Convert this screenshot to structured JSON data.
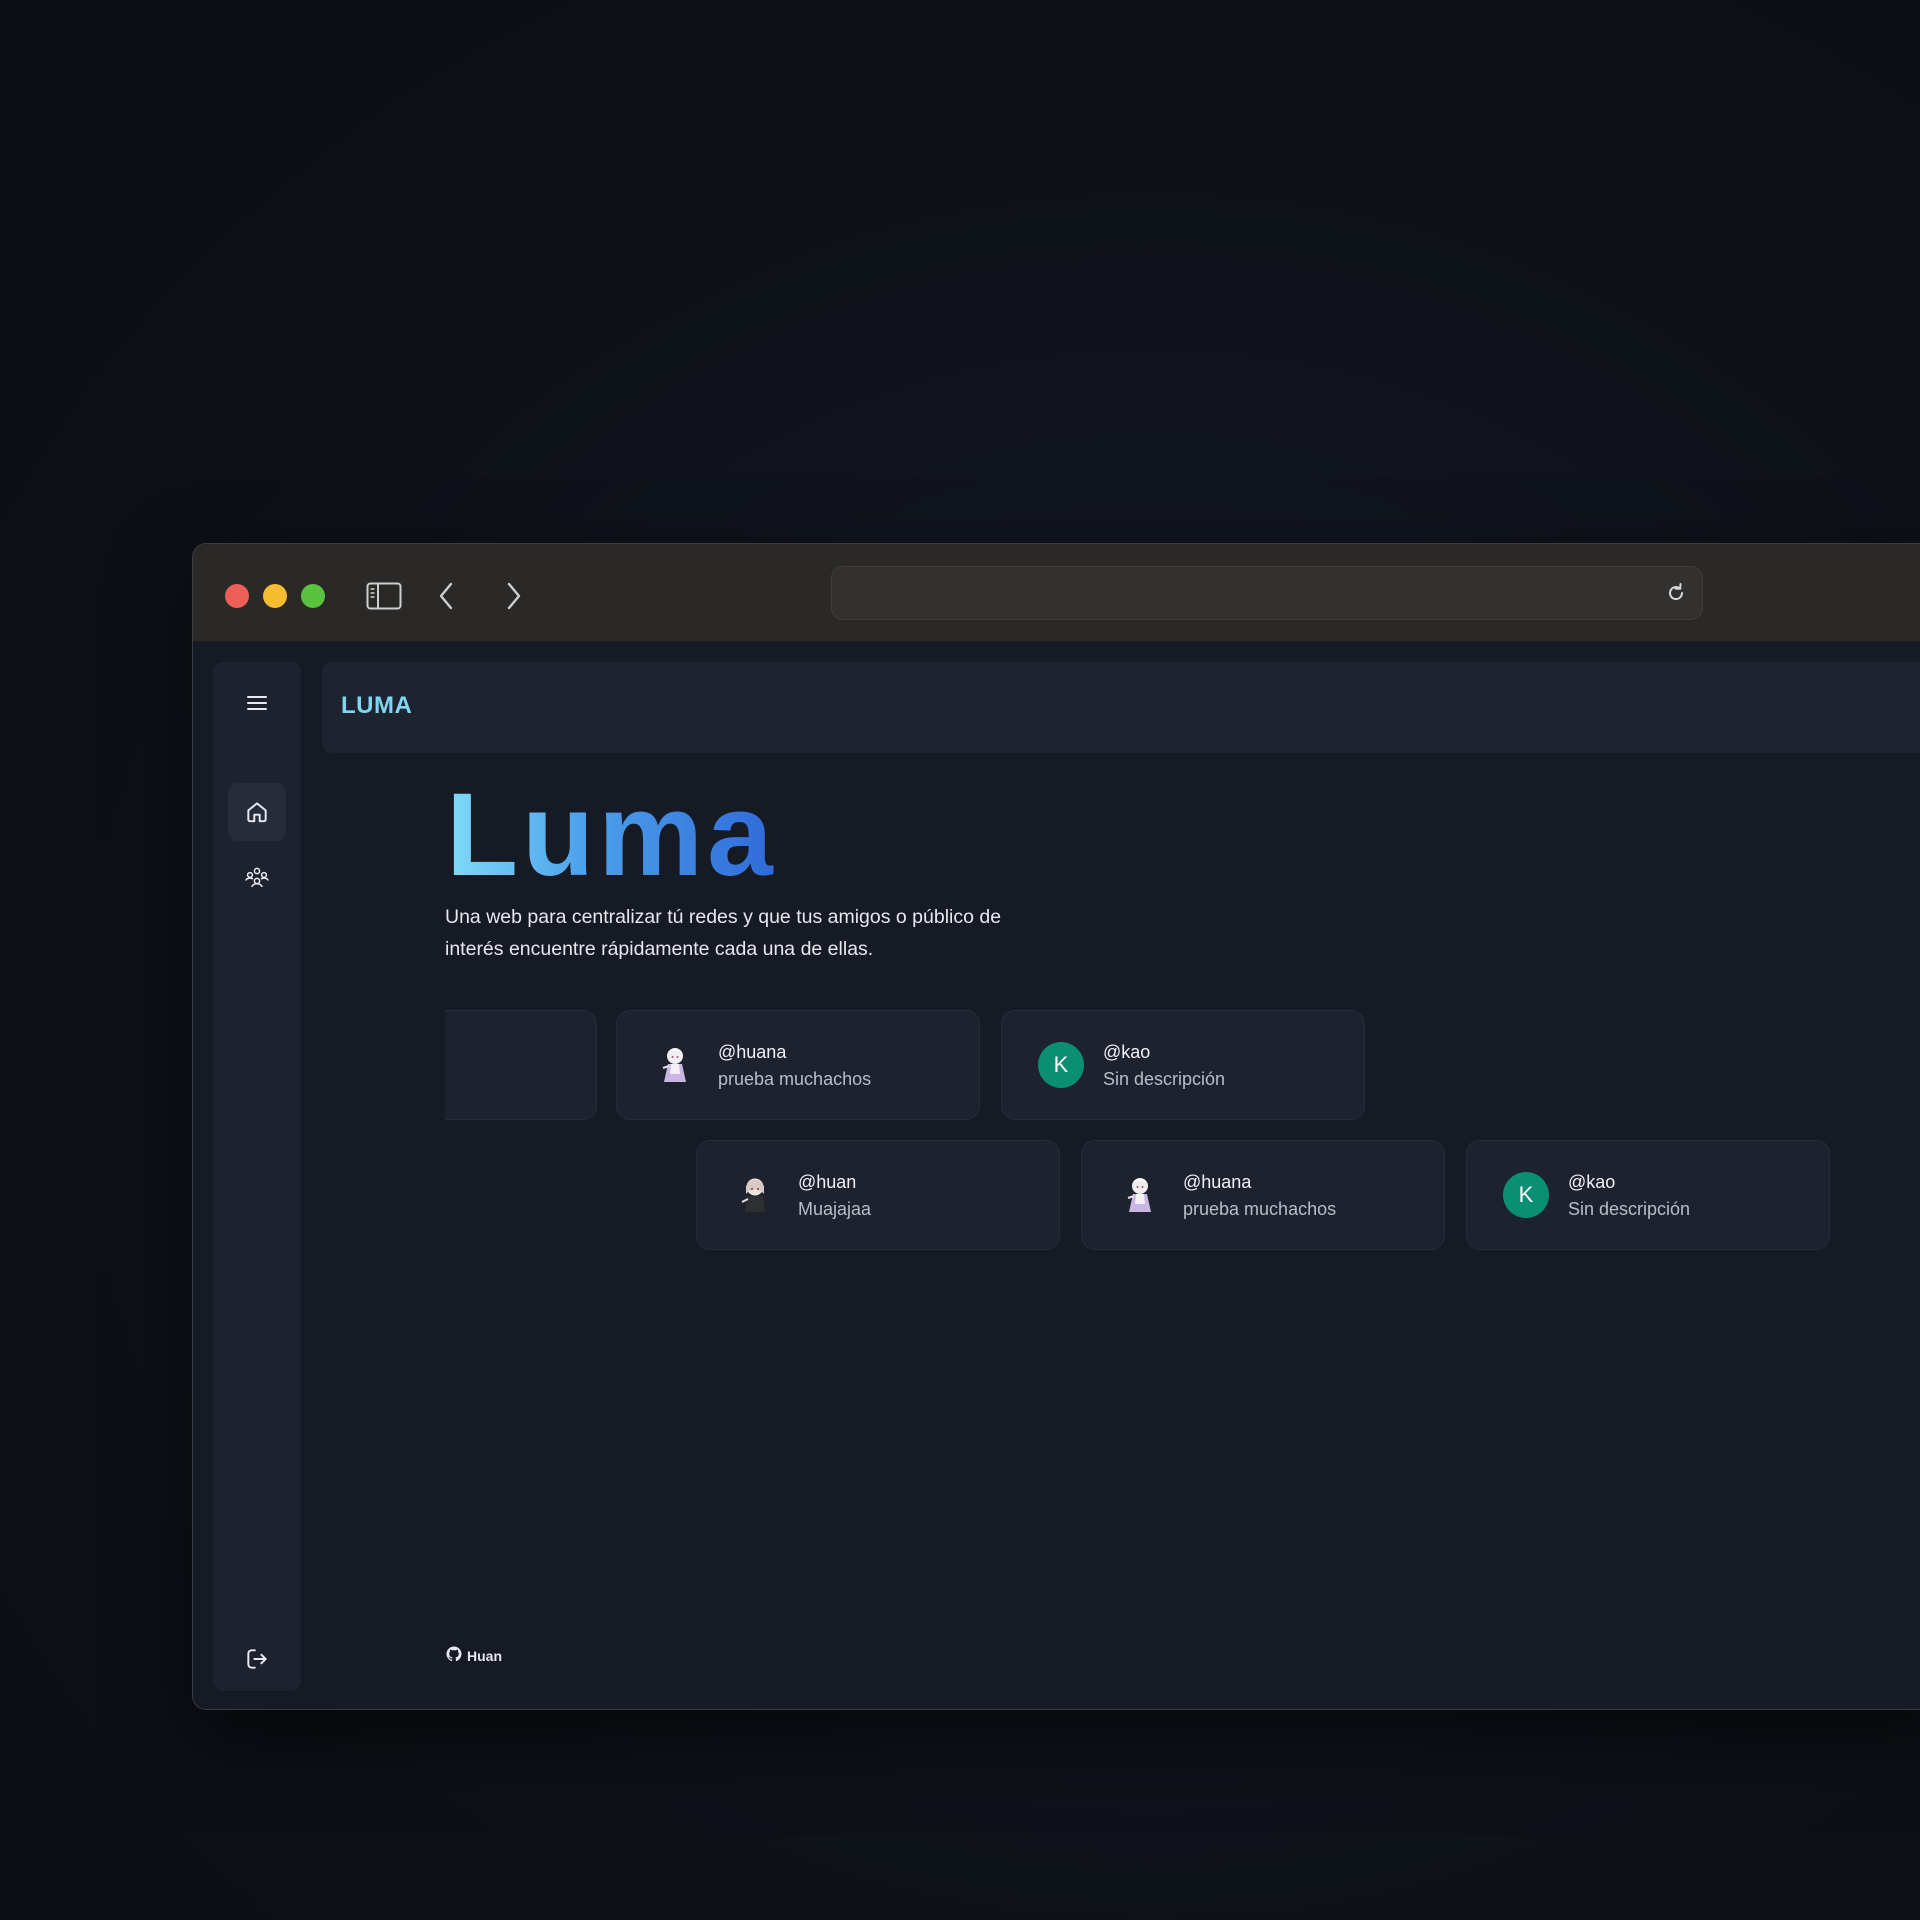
{
  "app": {
    "brand": "LUMA",
    "hero_title": "Luma",
    "hero_description": "Una web para centralizar tú redes y que tus amigos o público de interés encuentre rápidamente cada una de ellas."
  },
  "browser": {
    "address": ""
  },
  "sidebar": {
    "icons": [
      "menu-icon",
      "home-icon",
      "friends-icon",
      "logout-icon"
    ],
    "active": "home"
  },
  "cards_row1": [
    {
      "handle": "",
      "description": "",
      "avatar": "none"
    },
    {
      "handle": "@huana",
      "description": "prueba muchachos",
      "avatar": "image"
    },
    {
      "handle": "@kao",
      "description": "Sin descripción",
      "avatar": "K"
    }
  ],
  "cards_row2": [
    {
      "handle": "@huan",
      "description": "Muajajaa",
      "avatar": "image"
    },
    {
      "handle": "@huana",
      "description": "prueba muchachos",
      "avatar": "image"
    },
    {
      "handle": "@kao",
      "description": "Sin descripción",
      "avatar": "K"
    }
  ],
  "footer": {
    "github_label": "Huan"
  },
  "colors": {
    "accent": "#7fd6f2",
    "gradient_start": "#7fdcf8",
    "gradient_end": "#2e6ad8",
    "avatar_letter_bg": "#0b8f73"
  }
}
